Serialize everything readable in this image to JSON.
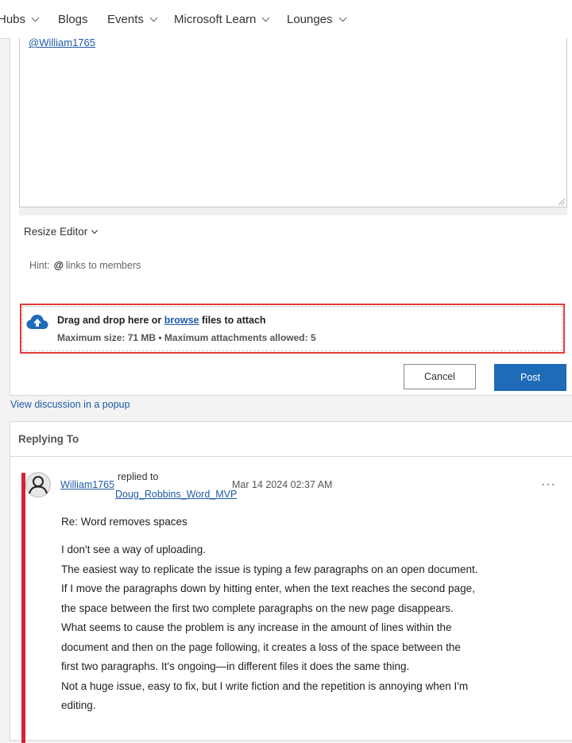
{
  "nav": {
    "items": [
      {
        "label": "Hubs",
        "has_dropdown": true
      },
      {
        "label": "Blogs",
        "has_dropdown": false
      },
      {
        "label": "Events",
        "has_dropdown": true
      },
      {
        "label": "Microsoft Learn",
        "has_dropdown": true
      },
      {
        "label": "Lounges",
        "has_dropdown": true
      }
    ]
  },
  "editor": {
    "mention": "@William1765",
    "resize_label": "Resize Editor",
    "hint_label": "Hint:",
    "hint_symbol": "@",
    "hint_text": "links to members"
  },
  "attach": {
    "text_before": "Drag and drop here or ",
    "browse_link": "browse",
    "text_after": " files to attach",
    "limits": "Maximum size: 71 MB • Maximum attachments allowed: 5",
    "icon": "cloud-upload-icon"
  },
  "actions": {
    "cancel_label": "Cancel",
    "post_label": "Post"
  },
  "popup_link": "View discussion in a popup",
  "replying": {
    "header": "Replying To",
    "author": "William1765",
    "replied_to_label": "replied to",
    "target": "Doug_Robbins_Word_MVP",
    "timestamp": "Mar 14 2024 02:37 AM",
    "more_label": "···",
    "subject": "Re: Word removes spaces",
    "body": [
      "I don't see a way of uploading.",
      "The easiest way to replicate the issue is typing a few paragraphs on an open document.",
      "If I move the paragraphs down by hitting enter, when the text reaches the second page,",
      "the space between the first two complete paragraphs on the new page disappears.",
      "What seems to cause the problem is any increase in the amount of lines within the",
      "document and then on the page following, it creates a loss of the space between the",
      "first two paragraphs. It's ongoing—in different files it does the same thing.",
      "Not a huge issue, easy to fix, but I write fiction and the repetition is annoying when I'm",
      "editing."
    ]
  },
  "colors": {
    "accent": "#1e6bb8",
    "link": "#1e5aa8",
    "highlight_border": "#e33b3b",
    "reply_bar": "#d71f3a"
  }
}
